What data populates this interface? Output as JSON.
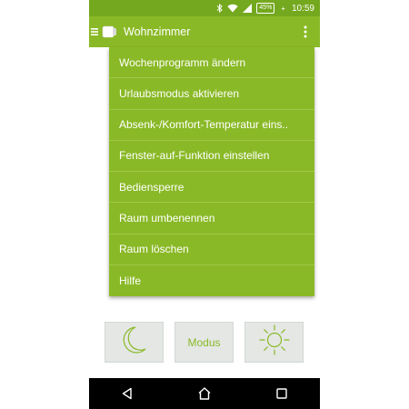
{
  "status_bar": {
    "battery_percent": "45%",
    "battery_charging_symbol": "+",
    "time": "10:59",
    "icons": [
      "bluetooth-icon",
      "wifi-icon",
      "signal-icon",
      "battery-icon"
    ]
  },
  "app_bar": {
    "title": "Wohnzimmer",
    "icons": [
      "menu-icon",
      "thermostat-icon",
      "overflow-menu-icon"
    ]
  },
  "dropdown": {
    "items": [
      "Wochenprogramm ändern",
      "Urlaubsmodus aktivieren",
      "Absenk-/Komfort-Temperatur eins..",
      "Fenster-auf-Funktion einstellen",
      "Bediensperre",
      "Raum umbenennen",
      "Raum löschen",
      "Hilfe"
    ]
  },
  "controls": {
    "moon_icon": "moon-icon",
    "modus_label": "Modus",
    "sun_icon": "sun-icon"
  },
  "nav_bar": {
    "icons": [
      "back-icon",
      "home-icon",
      "recents-icon"
    ]
  },
  "colors": {
    "status_bar": "#74a81e",
    "app_bar": "#8ab927",
    "menu_bg": "#8ab927",
    "control_bg": "#e4e7e4",
    "accent": "#8ab927",
    "nav_bar": "#000000"
  }
}
